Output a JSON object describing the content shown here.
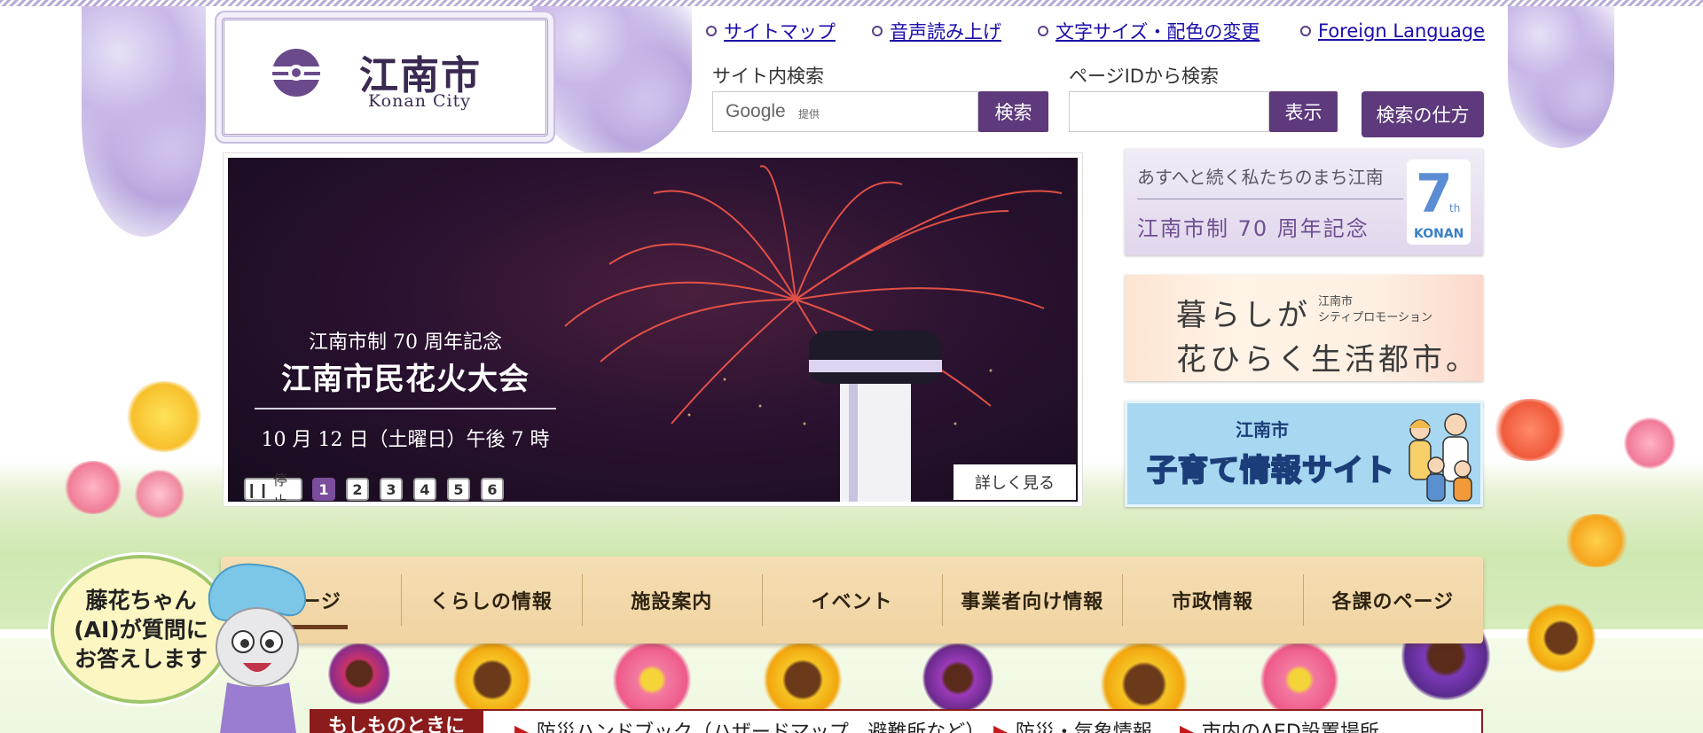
{
  "logo": {
    "jp": "江南市",
    "en": "Konan City"
  },
  "util_links": [
    "サイトマップ",
    "音声読み上げ",
    "文字サイズ・配色の変更",
    "Foreign Language"
  ],
  "site_search": {
    "label": "サイト内検索",
    "google": "Google",
    "provided": "提供",
    "button": "検索"
  },
  "page_id_search": {
    "label": "ページIDから検索",
    "button": "表示"
  },
  "search_help_button": "検索の仕方",
  "slider": {
    "subtitle": "江南市制 70 周年記念",
    "title": "江南市民花火大会",
    "date": "10 月 12 日（土曜日）午後 7 時",
    "stop": "停止",
    "pages": [
      "1",
      "2",
      "3",
      "4",
      "5",
      "6"
    ],
    "active_page": 1,
    "more": "詳しく見る"
  },
  "banners": {
    "anniv": {
      "line1": "あすへと続く私たちのまち江南",
      "line2": "江南市制 70 周年記念",
      "num": "7",
      "th": "th",
      "konan": "KONAN"
    },
    "promo": {
      "line1": "暮らしが",
      "small1": "江南市",
      "small2": "シティプロモーション",
      "line2": "花ひらく生活都市。"
    },
    "kosodate": {
      "line1": "江南市",
      "line2": "子育て情報サイト"
    }
  },
  "nav": [
    "ページ",
    "くらしの情報",
    "施設案内",
    "イベント",
    "事業者向け情報",
    "市政情報",
    "各課のページ"
  ],
  "ai_bubble": [
    "藤花ちゃん",
    "(AI)が質問に",
    "お答えします"
  ],
  "bottom": {
    "tab": "もしものときに",
    "links": [
      "防災ハンドブック（ハザードマップ、避難所など）",
      "防災・気象情報",
      "市内のAED設置場所"
    ]
  },
  "colors": {
    "brand_purple": "#5e3a7c",
    "nav_wood": "#f0d3a0",
    "alert_red": "#8c1b1b",
    "link": "#1a0dab"
  }
}
